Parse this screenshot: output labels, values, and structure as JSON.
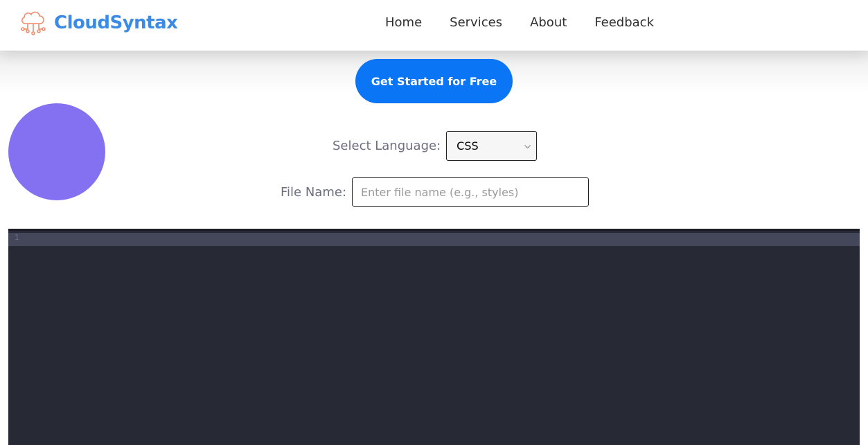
{
  "brand": {
    "name": "CloudSyntax",
    "icon": "cloud-network-icon",
    "name_color": "#3b8be6",
    "icon_color": "#f08a6c"
  },
  "nav": {
    "items": [
      {
        "label": "Home"
      },
      {
        "label": "Services"
      },
      {
        "label": "About"
      },
      {
        "label": "Feedback"
      }
    ]
  },
  "cta": {
    "label": "Get Started for Free",
    "color": "#0a75f5"
  },
  "decor": {
    "circle_color": "#8471f2"
  },
  "form": {
    "language_label": "Select Language:",
    "language_selected": "CSS",
    "file_label": "File Name:",
    "file_placeholder": "Enter file name (e.g., styles)",
    "file_value": ""
  },
  "editor": {
    "line_numbers": [
      "1"
    ],
    "background": "#272935"
  }
}
